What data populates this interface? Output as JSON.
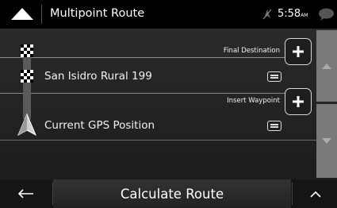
{
  "title": "Multipoint Route",
  "status": {
    "time": "5:58",
    "ampm": "AM"
  },
  "icons": {
    "menu": "triangle-menu-icon",
    "gps": "gps-off-icon",
    "messages": "message-bubble-icon",
    "add": "plus-icon",
    "details": "details-icon",
    "destination": "checkered-flag-icon",
    "position": "arrow-position-icon",
    "back": "arrow-left-icon",
    "expand": "chevron-up-icon"
  },
  "final_destination": {
    "label": "Final Destination"
  },
  "waypoints": [
    {
      "label": "San Isidro Rural 199"
    }
  ],
  "insert_waypoint": {
    "label": "Insert Waypoint"
  },
  "current_position": {
    "label": "Current GPS Position"
  },
  "footer": {
    "calculate_label": "Calculate Route"
  },
  "colors": {
    "scrollbar": "#7a7a7a",
    "background": "#1e1e1e",
    "bar": "#000000"
  }
}
